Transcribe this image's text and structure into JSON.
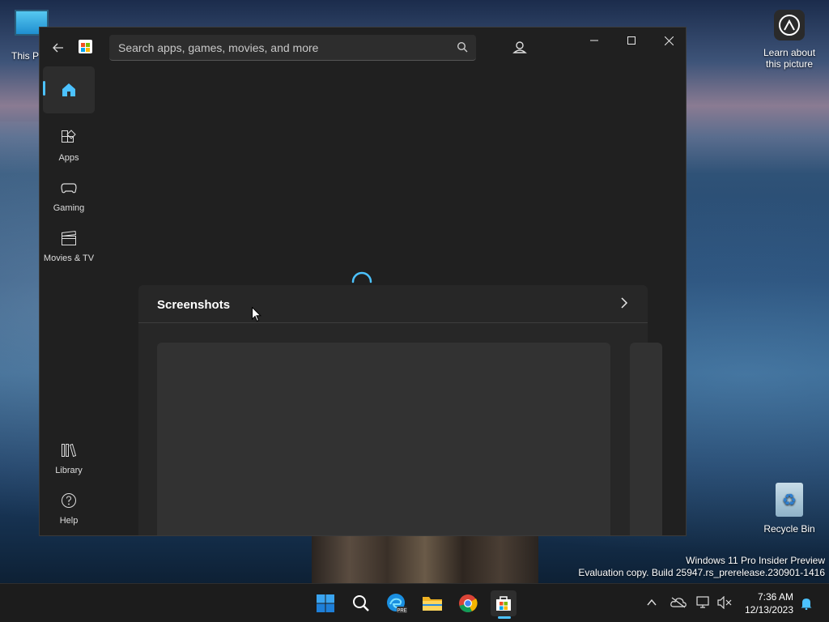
{
  "desktop": {
    "icons": {
      "this_pc": "This P",
      "learn": "Learn about this picture",
      "recycle_bin": "Recycle Bin"
    },
    "watermark": {
      "line1": "Windows 11 Pro Insider Preview",
      "line2": "Evaluation copy. Build 25947.rs_prerelease.230901-1416"
    }
  },
  "store": {
    "search_placeholder": "Search apps, games, movies, and more",
    "nav": {
      "apps": "Apps",
      "gaming": "Gaming",
      "movies_tv": "Movies & TV",
      "library": "Library",
      "help": "Help"
    },
    "section": {
      "title": "Screenshots"
    },
    "colors": {
      "accent": "#4cc2ff",
      "window_bg": "#202020",
      "card_bg": "#272727"
    }
  },
  "taskbar": {
    "time": "7:36 AM",
    "date": "12/13/2023",
    "pinned": [
      "start-icon",
      "search-icon",
      "edge-beta-icon",
      "file-explorer-icon",
      "chrome-icon",
      "microsoft-store-icon"
    ]
  }
}
